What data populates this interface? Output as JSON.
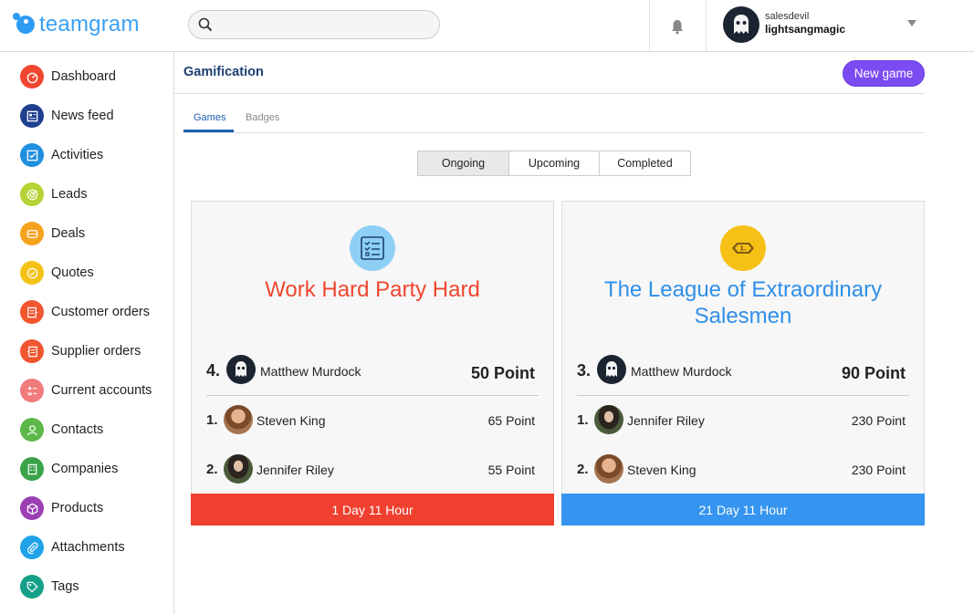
{
  "header": {
    "logo_text": "teamgram",
    "search_placeholder": "",
    "user": {
      "account": "salesdevil",
      "name": "lightsangmagic"
    }
  },
  "sidebar": {
    "items": [
      {
        "label": "Dashboard",
        "icon": "dashboard-icon",
        "color": "#f0462f"
      },
      {
        "label": "News feed",
        "icon": "news-feed-icon",
        "color": "#1f3f8f"
      },
      {
        "label": "Activities",
        "icon": "activities-icon",
        "color": "#1f8fe0"
      },
      {
        "label": "Leads",
        "icon": "leads-icon",
        "color": "#b5d334"
      },
      {
        "label": "Deals",
        "icon": "deals-icon",
        "color": "#f5a21f"
      },
      {
        "label": "Quotes",
        "icon": "quotes-icon",
        "color": "#f6c117"
      },
      {
        "label": "Customer orders",
        "icon": "customer-orders-icon",
        "color": "#f0562f"
      },
      {
        "label": "Supplier orders",
        "icon": "supplier-orders-icon",
        "color": "#f0562f"
      },
      {
        "label": "Current accounts",
        "icon": "current-accounts-icon",
        "color": "#f27b7b"
      },
      {
        "label": "Contacts",
        "icon": "contacts-icon",
        "color": "#5db84a"
      },
      {
        "label": "Companies",
        "icon": "companies-icon",
        "color": "#3aa34a"
      },
      {
        "label": "Products",
        "icon": "products-icon",
        "color": "#9b3fb5"
      },
      {
        "label": "Attachments",
        "icon": "attachments-icon",
        "color": "#1fa2e8"
      },
      {
        "label": "Tags",
        "icon": "tags-icon",
        "color": "#15a08a"
      }
    ]
  },
  "main": {
    "title": "Gamification",
    "new_game_label": "New game",
    "tabs": [
      {
        "label": "Games"
      },
      {
        "label": "Badges"
      }
    ],
    "segments": [
      {
        "label": "Ongoing"
      },
      {
        "label": "Upcoming"
      },
      {
        "label": "Completed"
      }
    ]
  },
  "games": [
    {
      "title": "Work Hard Party Hard",
      "title_color": "#f0462f",
      "icon": "checklist-icon",
      "icon_bg": "#8ed0f5",
      "my_rank": "4.",
      "my_name": "Matthew Murdock",
      "my_points": "50 Point",
      "leaders": [
        {
          "rank": "1.",
          "name": "Steven King",
          "points": "65 Point"
        },
        {
          "rank": "2.",
          "name": "Jennifer Riley",
          "points": "55 Point"
        }
      ],
      "remaining": "1 Day 11 Hour",
      "footer_color": "#f0402f"
    },
    {
      "title": "The League of Extraordinary Salesmen",
      "title_color": "#2f8fe8",
      "icon": "medal-icon",
      "icon_bg": "#f6c117",
      "my_rank": "3.",
      "my_name": "Matthew Murdock",
      "my_points": "90 Point",
      "leaders": [
        {
          "rank": "1.",
          "name": "Jennifer Riley",
          "points": "230 Point"
        },
        {
          "rank": "2.",
          "name": "Steven King",
          "points": "230 Point"
        }
      ],
      "remaining": "21 Day 11 Hour",
      "footer_color": "#3595f0"
    }
  ]
}
